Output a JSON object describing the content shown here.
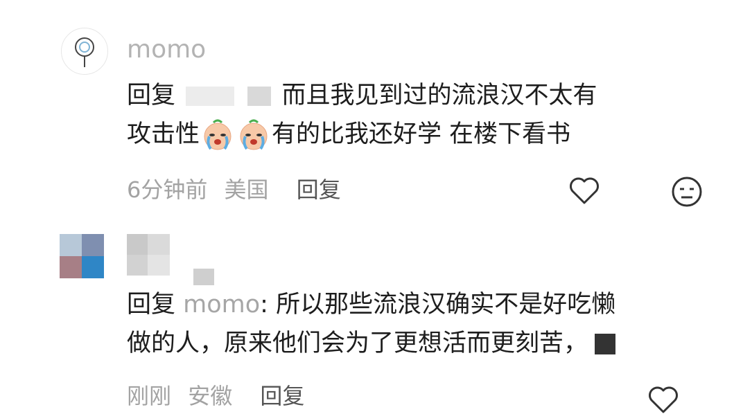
{
  "comments": [
    {
      "username": "momo",
      "reply_prefix": "回复",
      "text_line1": "而且我见到过的流浪汉不太有",
      "text_line2_a": "攻击性",
      "text_line2_b": "有的比我还好学 在楼下看书",
      "time": "6分钟前",
      "location": "美国",
      "reply_label": "回复",
      "icons": [
        "like-icon",
        "dislike-icon",
        "crying-emoji"
      ]
    },
    {
      "reply_prefix": "回复",
      "mention": "momo",
      "text_line1_a": ": 所以那些",
      "text_line1_b": "流浪汉确实不是好吃懒",
      "text_line2": "做的人，原来他们会为了更想活而更刻苦，",
      "time": "刚刚",
      "location": "安徽",
      "reply_label": "回复",
      "icons": [
        "like-icon"
      ]
    }
  ],
  "colors": {
    "text": "#1d1d1d",
    "muted": "#a3a3a3",
    "mention": "#a6a6a6",
    "icon": "#333333"
  }
}
